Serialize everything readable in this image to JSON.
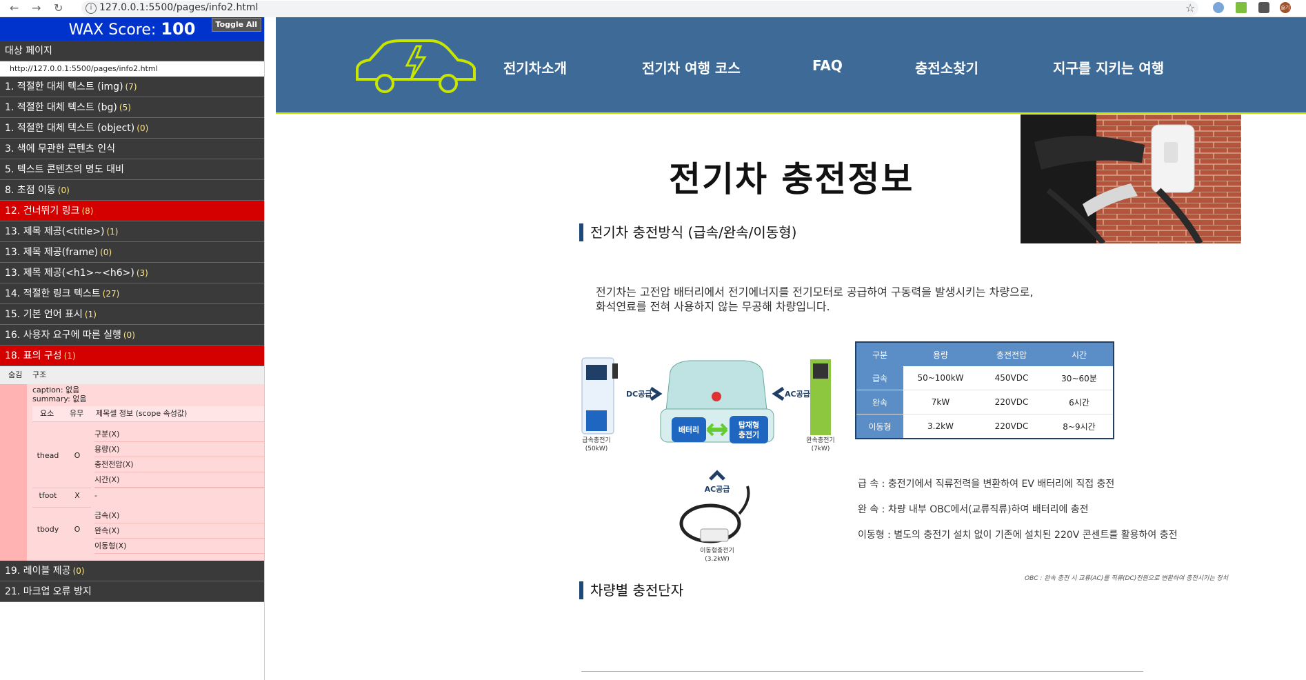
{
  "browser": {
    "url": "127.0.0.1:5500/pages/info2.html",
    "avatar_text": "슬기"
  },
  "sidebar": {
    "wax_label": "WAX Score:",
    "wax_score": "100",
    "toggle_label": "Toggle All",
    "target_page_label": "대상 페이지",
    "target_url": "http://127.0.0.1:5500/pages/info2.html",
    "items": [
      {
        "label": "1. 적절한 대체 텍스트 (img)",
        "count": "(7)"
      },
      {
        "label": "1. 적절한 대체 텍스트 (bg)",
        "count": "(5)"
      },
      {
        "label": "1. 적절한 대체 텍스트 (object)",
        "count": "(0)"
      },
      {
        "label": "3. 색에 무관한 콘텐츠 인식",
        "count": ""
      },
      {
        "label": "5. 텍스트 콘텐츠의 명도 대비",
        "count": ""
      },
      {
        "label": "8. 초점 이동",
        "count": "(0)"
      },
      {
        "label": "12. 건너뛰기 링크",
        "count": "(8)"
      },
      {
        "label": "13. 제목 제공(<title>)",
        "count": "(1)"
      },
      {
        "label": "13. 제목 제공(frame)",
        "count": "(0)"
      },
      {
        "label": "13. 제목 제공(<h1>~<h6>)",
        "count": "(3)"
      },
      {
        "label": "14. 적절한 링크 텍스트",
        "count": "(27)"
      },
      {
        "label": "15. 기본 언어 표시",
        "count": "(1)"
      },
      {
        "label": "16. 사용자 요구에 따른 실행",
        "count": "(0)"
      },
      {
        "label": "18. 표의 구성",
        "count": "(1)"
      }
    ],
    "items_after": [
      {
        "label": "19. 레이블 제공",
        "count": "(0)"
      },
      {
        "label": "21. 마크업 오류 방지",
        "count": ""
      }
    ],
    "detail": {
      "col_hide": "숨김",
      "col_struct": "구조",
      "caption_line": "caption: 없음",
      "summary_line": "summary: 없음",
      "h_element": "요소",
      "h_exist": "유무",
      "h_info": "제목셀 정보 (scope 속성값)",
      "thead_label": "thead",
      "thead_exist": "O",
      "thead_cells": [
        "구분(X)",
        "용량(X)",
        "충전전압(X)",
        "시간(X)"
      ],
      "tfoot_label": "tfoot",
      "tfoot_exist": "X",
      "tfoot_cells": [
        "-"
      ],
      "tbody_label": "tbody",
      "tbody_exist": "O",
      "tbody_cells": [
        "급속(X)",
        "완속(X)",
        "이동형(X)"
      ]
    }
  },
  "nav": {
    "items": [
      "전기차소개",
      "전기차 여행 코스",
      "FAQ",
      "충전소찾기",
      "지구를 지키는 여행"
    ]
  },
  "main": {
    "title": "전기차 충전정보",
    "section1": "전기차 충전방식 (급속/완속/이동형)",
    "para_line1": "전기차는 고전압 배터리에서 전기에너지를 전기모터로 공급하여 구동력을 발생시키는 차량으로,",
    "para_line2": "화석연료를 전혀 사용하지 않는 무공해 차량입니다.",
    "diagram": {
      "dc_label": "DC공급",
      "ac_label_right": "AC공급",
      "ac_label_bottom": "AC공급",
      "battery": "배터리",
      "onboard_1": "탑재형",
      "onboard_2": "충전기",
      "fast_charger": "급속충전기",
      "fast_charger_kw": "(50kW)",
      "slow_charger": "완속충전기",
      "slow_charger_kw": "(7kW)",
      "portable_charger": "이동형충전기",
      "portable_charger_kw": "(3.2kW)"
    },
    "table": {
      "headers": [
        "구분",
        "용량",
        "충전전압",
        "시간"
      ],
      "rows": [
        [
          "급속",
          "50~100kW",
          "450VDC",
          "30~60분"
        ],
        [
          "완속",
          "7kW",
          "220VDC",
          "6시간"
        ],
        [
          "이동형",
          "3.2kW",
          "220VDC",
          "8~9시간"
        ]
      ]
    },
    "desc": [
      "급 속 : 충전기에서 직류전력을 변환하여 EV 배터리에 직접 충전",
      "완 속 : 차량 내부 OBC에서(교류직류)하여 배터리에 충전",
      "이동형 : 별도의 충전기 설치 없이 기존에 설치된 220V 콘센트를 활용하여 충전"
    ],
    "note": "OBC : 완속 충전 시 교류(AC)를 직류(DC)전원으로 변환하여 충전시키는 장치",
    "section2": "차량별 충전단자"
  }
}
